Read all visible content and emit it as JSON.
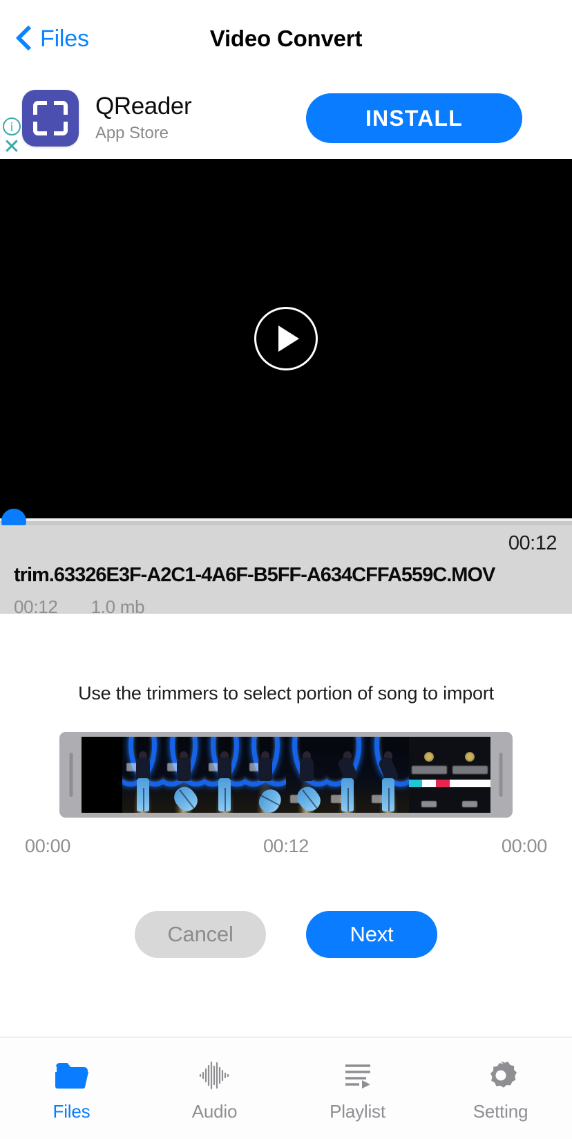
{
  "navbar": {
    "back_label": "Files",
    "back_icon": "chevron-left-icon",
    "title": "Video Convert"
  },
  "ad": {
    "icon": "qr-scan-frame-icon",
    "title": "QReader",
    "subtitle": "App Store",
    "install_label": "INSTALL",
    "info_icon": "info-circle-icon",
    "close_icon": "close-x-icon",
    "accent_color": "#0a7cff",
    "icon_color": "#4b4fb0",
    "meta_icon_color": "#3aa8a8"
  },
  "player": {
    "play_icon": "play-circle-icon",
    "background_color": "#000000",
    "seek_position_percent": 0,
    "seek_thumb_color": "#0a7cff"
  },
  "file": {
    "duration_right": "00:12",
    "name": "trim.63326E3F-A2C1-4A6F-B5FF-A634CFFA559C.MOV",
    "duration": "00:12",
    "size": "1.0 mb",
    "background_color": "#d6d6d6"
  },
  "trim": {
    "hint": "Use the trimmers to select portion of song to import",
    "left_handle_icon": "trim-handle-left-icon",
    "right_handle_icon": "trim-handle-right-icon",
    "start_time": "00:00",
    "total_time": "00:12",
    "end_time": "00:00",
    "frames": [
      {
        "kind": "black"
      },
      {
        "kind": "stage",
        "pose": "stand"
      },
      {
        "kind": "stage",
        "pose": "kick"
      },
      {
        "kind": "stage",
        "pose": "stand"
      },
      {
        "kind": "stage",
        "pose": "kick2"
      },
      {
        "kind": "stage",
        "pose": "kick"
      },
      {
        "kind": "stage",
        "pose": "lean"
      },
      {
        "kind": "stage",
        "pose": "lean"
      },
      {
        "kind": "endcard"
      },
      {
        "kind": "endcard"
      }
    ]
  },
  "actions": {
    "cancel_label": "Cancel",
    "next_label": "Next",
    "cancel_color": "#d8d8d8",
    "next_color": "#0a7cff"
  },
  "tabbar": {
    "items": [
      {
        "label": "Files",
        "icon": "folder-icon",
        "active": true
      },
      {
        "label": "Audio",
        "icon": "waveform-icon",
        "active": false
      },
      {
        "label": "Playlist",
        "icon": "playlist-icon",
        "active": false
      },
      {
        "label": "Setting",
        "icon": "gear-icon",
        "active": false
      }
    ],
    "active_color": "#0a7cff",
    "inactive_color": "#8e8e93"
  }
}
